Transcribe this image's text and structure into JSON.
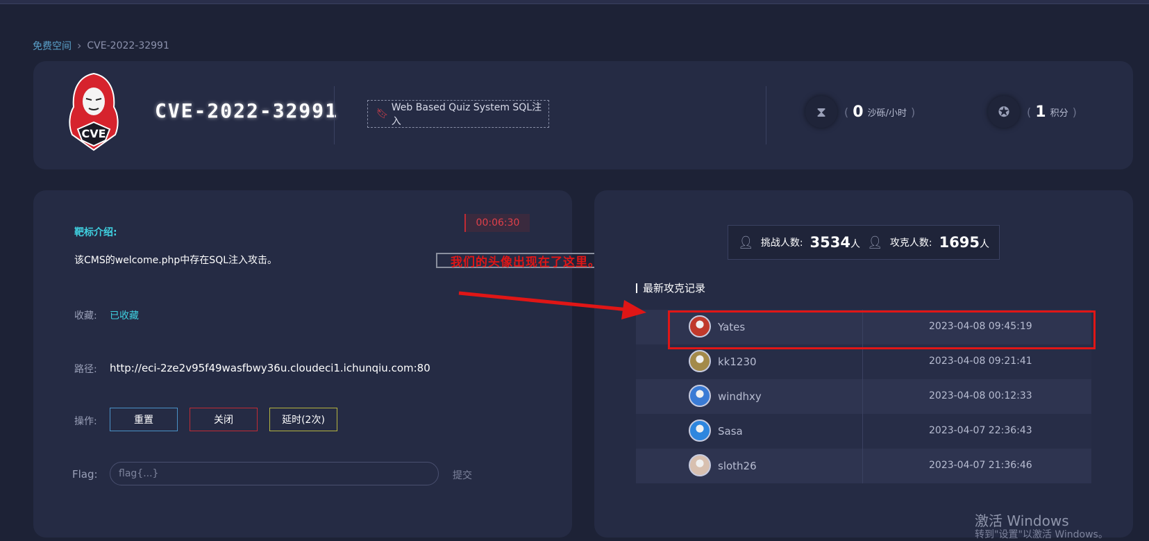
{
  "breadcrumb": {
    "root": "免费空间",
    "current": "CVE-2022-32991"
  },
  "header": {
    "logo_text": "CVE",
    "title": "CVE-2022-32991",
    "tag": "Web Based Quiz System SQL注入",
    "sand": {
      "value": "0",
      "unit": "沙砾/小时"
    },
    "score": {
      "value": "1",
      "unit": "积分"
    }
  },
  "target": {
    "timer": "00:06:30",
    "intro_label": "靶标介绍:",
    "intro_text": "该CMS的welcome.php中存在SQL注入攻击。",
    "favorite_label": "收藏:",
    "favorite_value": "已收藏",
    "path_label": "路径:",
    "path_value": "http://eci-2ze2v95f49wasfbwy36u.cloudeci1.ichunqiu.com:80",
    "actions_label": "操作:",
    "btn_reset": "重置",
    "btn_close": "关闭",
    "btn_delay": "延时(2次)",
    "flag_label": "Flag:",
    "flag_placeholder": "flag{...}",
    "submit": "提交"
  },
  "annotation": {
    "text": "我们的头像出现在了这里。",
    "color": "#e01616"
  },
  "stats": {
    "challengers_label": "挑战人数:",
    "challengers_value": "3534",
    "challengers_unit": "人",
    "solvers_label": "攻克人数:",
    "solvers_value": "1695",
    "solvers_unit": "人"
  },
  "records": {
    "title": "最新攻克记录",
    "rows": [
      {
        "name": "Yates",
        "time": "2023-04-08 09:45:19",
        "avatar_color": "#c0392b"
      },
      {
        "name": "kk1230",
        "time": "2023-04-08 09:21:41",
        "avatar_color": "#a38a4a"
      },
      {
        "name": "windhxy",
        "time": "2023-04-08 00:12:33",
        "avatar_color": "#3a7bd5"
      },
      {
        "name": "Sasa",
        "time": "2023-04-07 22:36:43",
        "avatar_color": "#2e86de"
      },
      {
        "name": "sloth26",
        "time": "2023-04-07 21:36:46",
        "avatar_color": "#d8c0b0"
      }
    ]
  },
  "watermark": {
    "line1": "激活 Windows",
    "line2": "转到\"设置\"以激活 Windows。"
  }
}
